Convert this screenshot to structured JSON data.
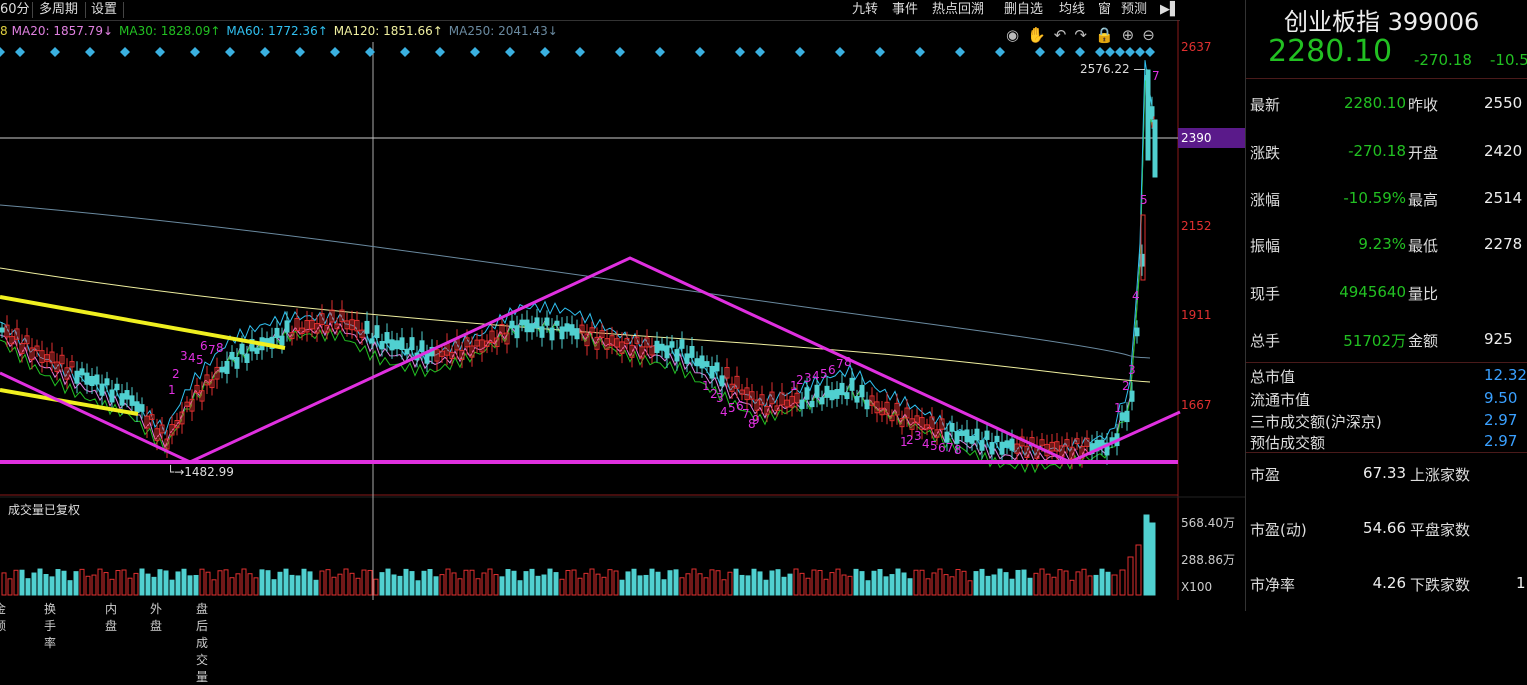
{
  "toolbar": {
    "period": "60分",
    "multi_period": "多周期",
    "settings": "设置",
    "right_buttons": [
      "九转",
      "事件",
      "热点回溯",
      "删自选",
      "均线",
      "窗",
      "预测"
    ]
  },
  "ma_line": {
    "ma10_prefix": "8",
    "ma20": "MA20: 1857.79↓",
    "ma30": "MA30: 1828.09↑",
    "ma60": "MA60: 1772.36↑",
    "ma120": "MA120: 1851.66↑",
    "ma250": "MA250: 2041.43↓"
  },
  "colors": {
    "ma20": "#e080e0",
    "ma30": "#22c022",
    "ma60": "#30c0f0",
    "ma120": "#f0f0a0",
    "ma250": "#6a8aa0",
    "up": "#e03030",
    "down": "#50d0d0",
    "pattern": "#e030e0",
    "trend": "#f0f020"
  },
  "price_axis": {
    "ticks": [
      "2637",
      "2390",
      "2152",
      "1911",
      "1667"
    ],
    "highlight": "2390"
  },
  "annotations": {
    "high": "2576.22",
    "low": "1482.99"
  },
  "volume": {
    "title": "成交量已复权",
    "ticks": [
      "568.40万",
      "288.86万",
      "X100"
    ]
  },
  "bottom_tabs": [
    "金额",
    "换手率",
    "内盘",
    "外盘",
    "盘后成交量"
  ],
  "quote": {
    "name": "创业板指 399006",
    "price": "2280.10",
    "change": "-270.18",
    "change_pct": "-10.5",
    "rows": [
      {
        "l1": "最新",
        "v1": "2280.10",
        "l2": "昨收",
        "v2": "2550"
      },
      {
        "l1": "涨跌",
        "v1": "-270.18",
        "l2": "开盘",
        "v2": "2420"
      },
      {
        "l1": "涨幅",
        "v1": "-10.59%",
        "l2": "最高",
        "v2": "2514"
      },
      {
        "l1": "振幅",
        "v1": "9.23%",
        "l2": "最低",
        "v2": "2278"
      },
      {
        "l1": "现手",
        "v1": "4945640",
        "l2": "量比",
        "v2": ""
      },
      {
        "l1": "总手",
        "v1": "51702万",
        "l2": "金额",
        "v2": "925"
      }
    ],
    "market": [
      {
        "l": "总市值",
        "v": "12.32"
      },
      {
        "l": "流通市值",
        "v": "9.50"
      },
      {
        "l": "三市成交额(沪深京)",
        "v": "2.97"
      },
      {
        "l": "预估成交额",
        "v": "2.97"
      }
    ],
    "ratios": [
      {
        "l1": "市盈",
        "v1": "67.33",
        "l2": "上涨家数",
        "v2": ""
      },
      {
        "l1": "市盈(动)",
        "v1": "54.66",
        "l2": "平盘家数",
        "v2": ""
      },
      {
        "l1": "市净率",
        "v1": "4.26",
        "l2": "下跌家数",
        "v2": "1"
      }
    ]
  }
}
